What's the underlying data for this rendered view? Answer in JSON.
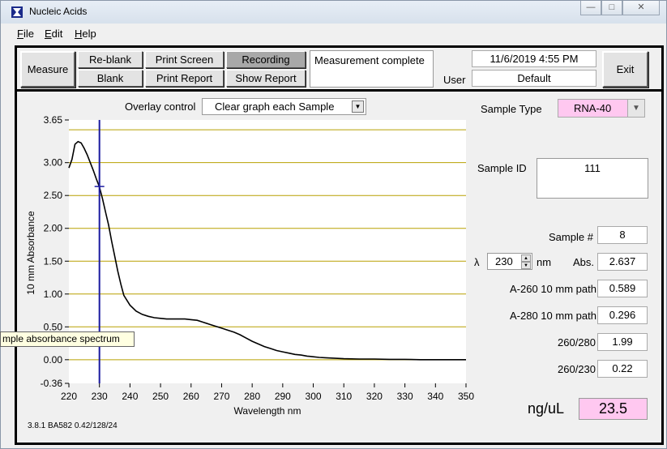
{
  "window": {
    "title": "Nucleic Acids"
  },
  "menu": [
    {
      "key": "F",
      "rest": "ile"
    },
    {
      "key": "E",
      "rest": "dit"
    },
    {
      "key": "H",
      "rest": "elp"
    }
  ],
  "toolbar": {
    "measure": "Measure",
    "reblank": "Re-blank",
    "blank": "Blank",
    "print_screen": "Print Screen",
    "print_report": "Print Report",
    "recording": "Recording",
    "show_report": "Show Report",
    "status": "Measurement complete",
    "datetime": "11/6/2019  4:55 PM",
    "user_label": "User",
    "user_value": "Default",
    "exit": "Exit"
  },
  "graph": {
    "overlay_label": "Overlay control",
    "overlay_value": "Clear graph each Sample",
    "tooltip": "mple absorbance spectrum",
    "footer": "3.8.1 BA582 0.42/128/24"
  },
  "right": {
    "sample_type_label": "Sample Type",
    "sample_type_value": "RNA-40",
    "sample_id_label": "Sample ID",
    "sample_id_value": "111",
    "sample_num_label": "Sample #",
    "sample_num_value": "8",
    "lambda_symbol": "λ",
    "lambda_value": "230",
    "lambda_unit": "nm",
    "abs_label": "Abs.",
    "abs_value": "2.637",
    "a260_label": "A-260 10 mm path",
    "a260_value": "0.589",
    "a280_label": "A-280 10 mm path",
    "a280_value": "0.296",
    "r260_280_label": "260/280",
    "r260_280_value": "1.99",
    "r260_230_label": "260/230",
    "r260_230_value": "0.22",
    "conc_label": "ng/uL",
    "conc_value": "23.5"
  },
  "colors": {
    "accent_pink": "#ffc8f0",
    "gridline": "#b8a000",
    "cursor": "#1a1aa0"
  },
  "chart_data": {
    "type": "line",
    "xlabel": "Wavelength nm",
    "ylabel": "10 mm Absorbance",
    "xlim": [
      220,
      350
    ],
    "ylim": [
      -0.36,
      3.65
    ],
    "xticks": [
      "220",
      "230",
      "240",
      "250",
      "260",
      "270",
      "280",
      "290",
      "300",
      "310",
      "320",
      "330",
      "340",
      "350"
    ],
    "yticks": [
      "3.65",
      "3.00",
      "2.50",
      "2.00",
      "1.50",
      "1.00",
      "0.50",
      "0.00",
      "-0.36"
    ],
    "gridlines_y": [
      3.5,
      3.0,
      2.5,
      2.0,
      1.5,
      1.0,
      0.5,
      0.0
    ],
    "cursor_x": 230,
    "series": [
      {
        "x": [
          220,
          221,
          222,
          223,
          224,
          225,
          226,
          227,
          228,
          229,
          230,
          231,
          232,
          233,
          234,
          235,
          236,
          237,
          238,
          240,
          242,
          244,
          246,
          248,
          250,
          252,
          254,
          256,
          258,
          260,
          262,
          264,
          266,
          268,
          270,
          272,
          274,
          276,
          278,
          280,
          282,
          284,
          286,
          288,
          290,
          292,
          294,
          296,
          298,
          300,
          302,
          304,
          306,
          308,
          310,
          315,
          320,
          325,
          330,
          335,
          340,
          345,
          350
        ],
        "y": [
          2.92,
          3.05,
          3.28,
          3.32,
          3.3,
          3.22,
          3.12,
          3.0,
          2.88,
          2.75,
          2.63,
          2.45,
          2.25,
          2.05,
          1.8,
          1.58,
          1.35,
          1.15,
          0.98,
          0.83,
          0.74,
          0.69,
          0.66,
          0.64,
          0.63,
          0.62,
          0.62,
          0.62,
          0.62,
          0.61,
          0.6,
          0.57,
          0.54,
          0.51,
          0.48,
          0.45,
          0.42,
          0.38,
          0.33,
          0.28,
          0.24,
          0.2,
          0.17,
          0.14,
          0.12,
          0.1,
          0.08,
          0.07,
          0.055,
          0.045,
          0.035,
          0.03,
          0.025,
          0.02,
          0.015,
          0.01,
          0.01,
          0.005,
          0.005,
          0.0,
          0.0,
          0.0,
          0.0
        ]
      }
    ]
  }
}
